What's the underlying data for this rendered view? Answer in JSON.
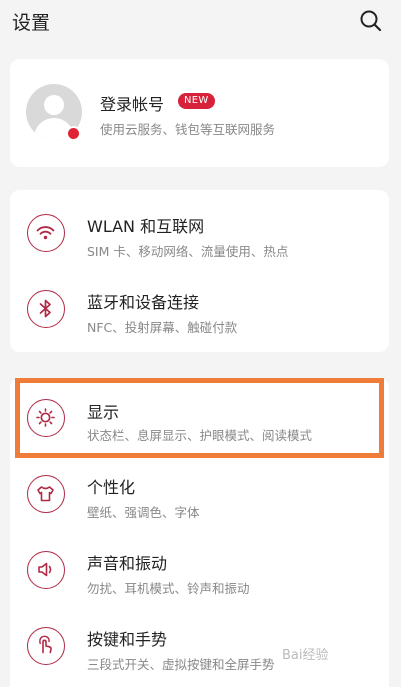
{
  "header": {
    "title": "设置",
    "search_icon": "search-icon"
  },
  "account": {
    "title": "登录帐号",
    "badge": "NEW",
    "subtitle": "使用云服务、钱包等互联网服务",
    "avatar_icon": "avatar-icon"
  },
  "connections": [
    {
      "title": "WLAN 和互联网",
      "subtitle": "SIM 卡、移动网络、流量使用、热点",
      "icon": "wifi-icon"
    },
    {
      "title": "蓝牙和设备连接",
      "subtitle": "NFC、投射屏幕、触碰付款",
      "icon": "bluetooth-icon"
    }
  ],
  "display_group": [
    {
      "title": "显示",
      "subtitle": "状态栏、息屏显示、护眼模式、阅读模式",
      "icon": "brightness-icon"
    },
    {
      "title": "个性化",
      "subtitle": "壁纸、强调色、字体",
      "icon": "tshirt-icon"
    },
    {
      "title": "声音和振动",
      "subtitle": "勿扰、耳机模式、铃声和振动",
      "icon": "speaker-icon"
    },
    {
      "title": "按键和手势",
      "subtitle": "三段式开关、虚拟按键和全屏手势",
      "icon": "gesture-icon"
    }
  ],
  "colors": {
    "accent": "#b02a45",
    "badge": "#d6223a",
    "highlight_border": "#f07c3a"
  },
  "watermark": "Bai经验"
}
